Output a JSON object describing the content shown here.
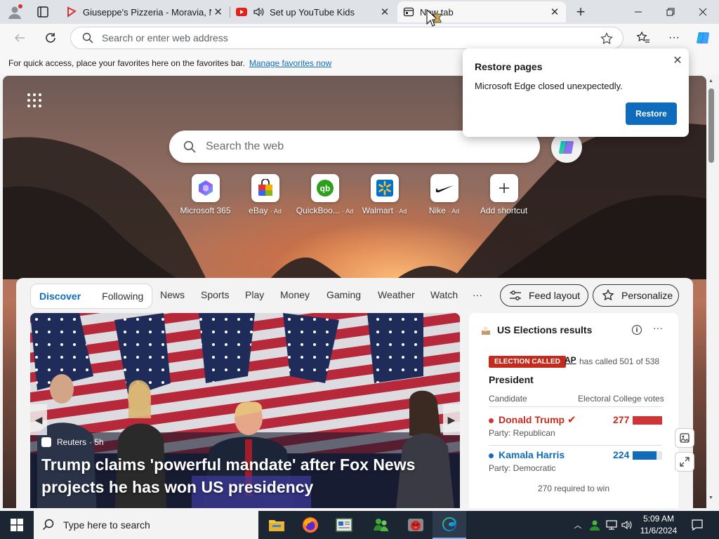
{
  "browser": {
    "tabs": [
      {
        "title": "Giuseppe's Pizzeria - Moravia, NY",
        "favicon": "red-ticket-icon",
        "active": false
      },
      {
        "title": "Set up YouTube Kids",
        "favicon": "youtube-kids-icon",
        "active": false
      },
      {
        "title": "New tab",
        "favicon": "new-tab-page-icon",
        "active": true
      }
    ],
    "address_placeholder": "Search or enter web address"
  },
  "favorites_bar": {
    "message": "For quick access, place your favorites here on the favorites bar.",
    "link": "Manage favorites now"
  },
  "restore_popup": {
    "title": "Restore pages",
    "message": "Microsoft Edge closed unexpectedly.",
    "button": "Restore"
  },
  "newtab": {
    "search_placeholder": "Search the web",
    "shortcuts": [
      {
        "label": "Microsoft 365",
        "ad": "",
        "icon": "microsoft-365-icon"
      },
      {
        "label": "eBay",
        "ad": "· Ad",
        "icon": "ebay-bag-icon"
      },
      {
        "label": "QuickBoo...",
        "ad": "· Ad",
        "icon": "quickbooks-icon"
      },
      {
        "label": "Walmart",
        "ad": "· Ad",
        "icon": "walmart-spark-icon"
      },
      {
        "label": "Nike",
        "ad": "· Ad",
        "icon": "nike-swoosh-icon"
      },
      {
        "label": "Add shortcut",
        "ad": "",
        "icon": "plus-icon"
      }
    ]
  },
  "feed": {
    "pills": [
      "Discover",
      "Following"
    ],
    "nav": [
      "News",
      "Sports",
      "Play",
      "Money",
      "Gaming",
      "Weather",
      "Watch",
      "···"
    ],
    "feed_layout": "Feed layout",
    "personalize": "Personalize",
    "hero": {
      "source": "Reuters",
      "age": "· 5h",
      "headline": "Trump claims 'powerful mandate' after Fox News projects he has won US presidency"
    },
    "election": {
      "title": "US Elections results",
      "badge": "ELECTION CALLED",
      "ap": "AP",
      "called": "has called 501 of 538",
      "office": "President",
      "col_candidate": "Candidate",
      "col_votes": "Electoral College votes",
      "candidates": [
        {
          "name": "Donald Trump",
          "party": "Party: Republican",
          "votes": "277",
          "share": 1.0,
          "color": "#d13438"
        },
        {
          "name": "Kamala Harris",
          "party": "Party: Democratic",
          "votes": "224",
          "share": 0.81,
          "color": "#0f6cbd"
        }
      ],
      "needed": "270 required to win"
    }
  },
  "taskbar": {
    "search_placeholder": "Type here to search",
    "time": "5:09 AM",
    "date": "11/6/2024"
  }
}
